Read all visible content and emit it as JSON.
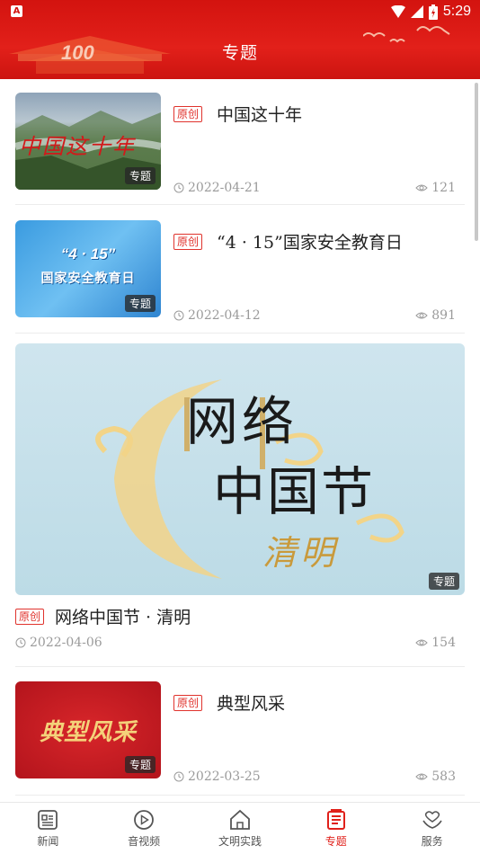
{
  "status_bar": {
    "time": "5:29",
    "app_icon_letter": "A"
  },
  "header": {
    "title": "专题"
  },
  "articles": [
    {
      "badge": "原创",
      "title": "中国这十年",
      "date": "2022-04-21",
      "views": "121",
      "tag": "专题",
      "thumb_text": "中国这十年"
    },
    {
      "badge": "原创",
      "title": "“4 · 15”国家安全教育日",
      "date": "2022-04-12",
      "views": "891",
      "tag": "专题",
      "thumb_text_top": "“4 · 15”",
      "thumb_text_bottom": "国家安全教育日"
    },
    {
      "badge": "原创",
      "title": "网络中国节 · 清明",
      "date": "2022-04-06",
      "views": "154",
      "tag": "专题",
      "banner_line1": "网络",
      "banner_line2": "中国节",
      "banner_line3": "清明"
    },
    {
      "badge": "原创",
      "title": "典型风采",
      "date": "2022-03-25",
      "views": "583",
      "tag": "专题",
      "thumb_text": "典型风采"
    }
  ],
  "bottom_nav": [
    {
      "label": "新闻",
      "icon": "news-icon",
      "active": false
    },
    {
      "label": "音视频",
      "icon": "play-icon",
      "active": false
    },
    {
      "label": "文明实践",
      "icon": "home-icon",
      "active": false
    },
    {
      "label": "专题",
      "icon": "topic-icon",
      "active": true
    },
    {
      "label": "服务",
      "icon": "service-icon",
      "active": false
    }
  ],
  "colors": {
    "brand_red": "#e0201a",
    "badge_red": "#e0332d",
    "meta_gray": "#9a9a9a"
  }
}
